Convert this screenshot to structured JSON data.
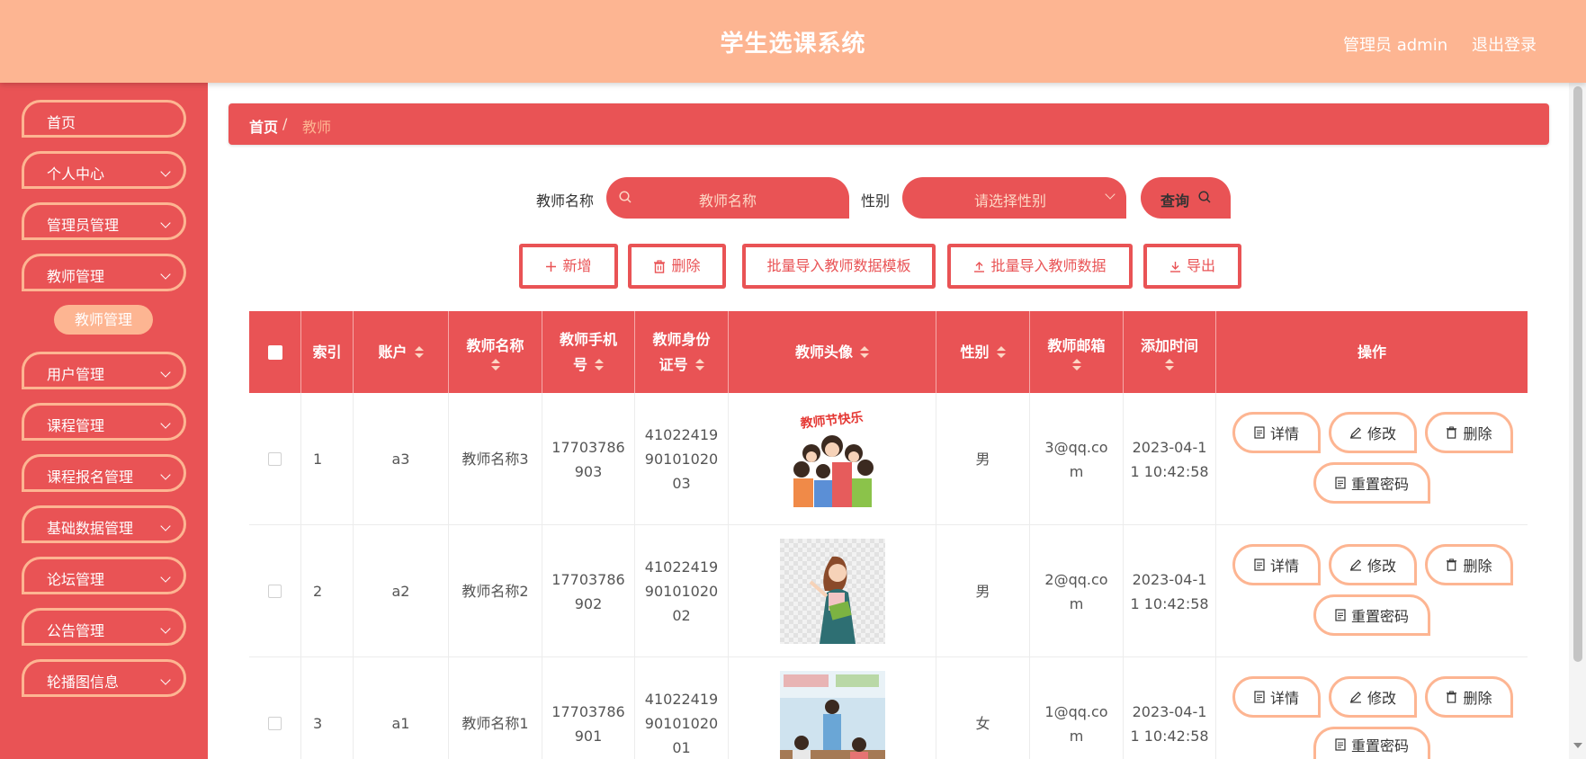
{
  "header": {
    "title": "学生选课系统",
    "user": "管理员 admin",
    "logout": "退出登录"
  },
  "sidebar": {
    "items": [
      {
        "label": "首页",
        "has_chevron": false
      },
      {
        "label": "个人中心",
        "has_chevron": true
      },
      {
        "label": "管理员管理",
        "has_chevron": true
      },
      {
        "label": "教师管理",
        "has_chevron": true
      },
      {
        "label": "用户管理",
        "has_chevron": true
      },
      {
        "label": "课程管理",
        "has_chevron": true
      },
      {
        "label": "课程报名管理",
        "has_chevron": true
      },
      {
        "label": "基础数据管理",
        "has_chevron": true
      },
      {
        "label": "论坛管理",
        "has_chevron": true
      },
      {
        "label": "公告管理",
        "has_chevron": true
      },
      {
        "label": "轮播图信息",
        "has_chevron": true
      }
    ],
    "active_sub": "教师管理"
  },
  "breadcrumb": {
    "home": "首页",
    "separator": "/",
    "current": "教师"
  },
  "search": {
    "name_label": "教师名称",
    "name_placeholder": "教师名称",
    "gender_label": "性别",
    "gender_placeholder": "请选择性别",
    "query_label": "查询"
  },
  "actions": {
    "add": "新增",
    "delete": "删除",
    "import_template": "批量导入教师数据模板",
    "import": "批量导入教师数据",
    "export": "导出"
  },
  "table": {
    "headers": {
      "index": "索引",
      "account": "账户",
      "name_1": "教师名称",
      "phone_1": "教师手机",
      "phone_2": "号",
      "idcard_1": "教师身份",
      "idcard_2": "证号",
      "avatar": "教师头像",
      "gender": "性别",
      "email": "教师邮箱",
      "added": "添加时间",
      "ops": "操作"
    },
    "rows": [
      {
        "index": "1",
        "account": "a3",
        "name": "教师名称3",
        "phone_1": "17703786",
        "phone_2": "903",
        "id_1": "41022419",
        "id_2": "90101020",
        "id_3": "03",
        "gender": "男",
        "email_1": "3@qq.co",
        "email_2": "m",
        "time_1": "2023-04-1",
        "time_2": "1 10:42:58"
      },
      {
        "index": "2",
        "account": "a2",
        "name": "教师名称2",
        "phone_1": "17703786",
        "phone_2": "902",
        "id_1": "41022419",
        "id_2": "90101020",
        "id_3": "02",
        "gender": "男",
        "email_1": "2@qq.co",
        "email_2": "m",
        "time_1": "2023-04-1",
        "time_2": "1 10:42:58"
      },
      {
        "index": "3",
        "account": "a1",
        "name": "教师名称1",
        "phone_1": "17703786",
        "phone_2": "901",
        "id_1": "41022419",
        "id_2": "90101020",
        "id_3": "01",
        "gender": "女",
        "email_1": "1@qq.co",
        "email_2": "m",
        "time_1": "2023-04-1",
        "time_2": "1 10:42:58"
      }
    ],
    "ops": {
      "detail": "详情",
      "edit": "修改",
      "delete": "删除",
      "reset": "重置密码"
    },
    "avatar_text": "教师节快乐"
  },
  "colors": {
    "accent": "#e95355",
    "header": "#fdb592",
    "button_text": "#e95355",
    "op_border": "#fdb592"
  }
}
